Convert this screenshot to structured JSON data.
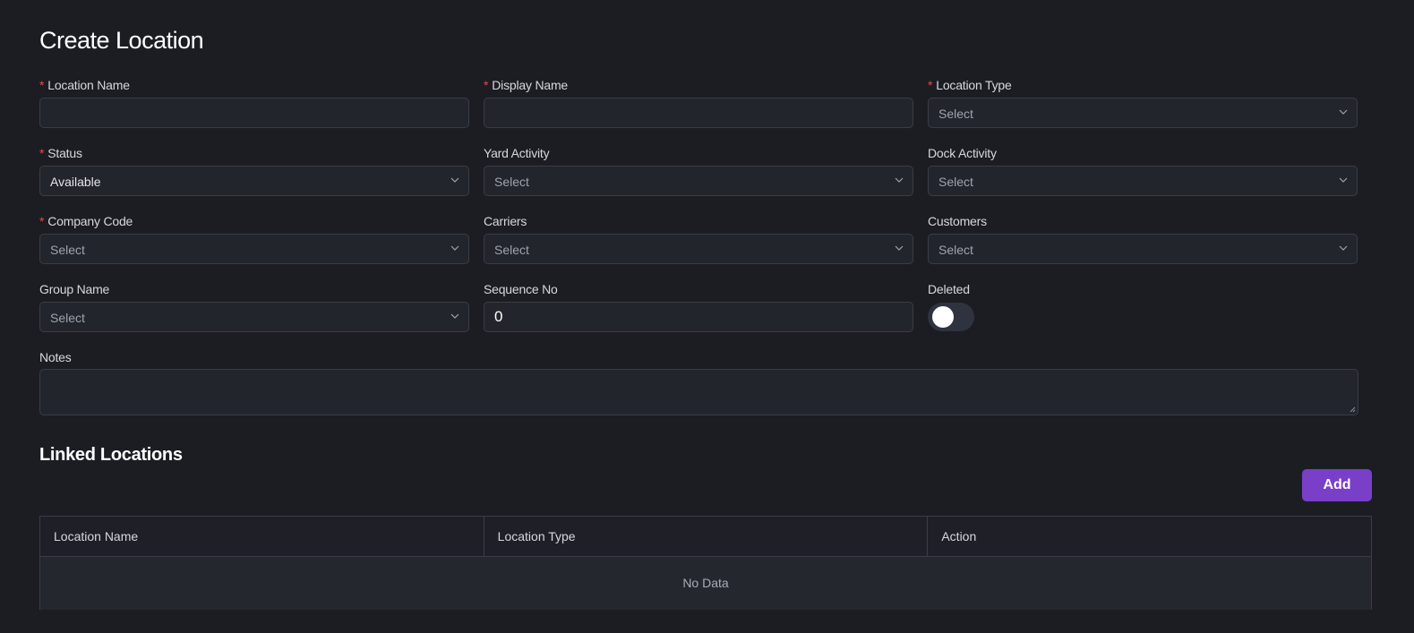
{
  "page": {
    "title": "Create Location"
  },
  "form": {
    "location_name": {
      "label": "Location Name",
      "value": ""
    },
    "display_name": {
      "label": "Display Name",
      "value": ""
    },
    "location_type": {
      "label": "Location Type",
      "value": "Select"
    },
    "status": {
      "label": "Status",
      "value": "Available"
    },
    "yard_activity": {
      "label": "Yard Activity",
      "value": "Select"
    },
    "dock_activity": {
      "label": "Dock Activity",
      "value": "Select"
    },
    "company_code": {
      "label": "Company Code",
      "value": "Select"
    },
    "carriers": {
      "label": "Carriers",
      "value": "Select"
    },
    "customers": {
      "label": "Customers",
      "value": "Select"
    },
    "group_name": {
      "label": "Group Name",
      "value": "Select"
    },
    "sequence_no": {
      "label": "Sequence No",
      "value": "0"
    },
    "deleted": {
      "label": "Deleted",
      "checked": false
    },
    "notes": {
      "label": "Notes",
      "value": ""
    },
    "required_marker": "*"
  },
  "linked_locations": {
    "title": "Linked Locations",
    "add_label": "Add",
    "columns": [
      "Location Name",
      "Location Type",
      "Action"
    ],
    "rows": [],
    "empty_text": "No Data"
  },
  "colors": {
    "background": "#1c1d23",
    "input_background": "#23252c",
    "border": "#3a3d47",
    "accent": "#7a3fc8",
    "required": "#e5484d"
  }
}
